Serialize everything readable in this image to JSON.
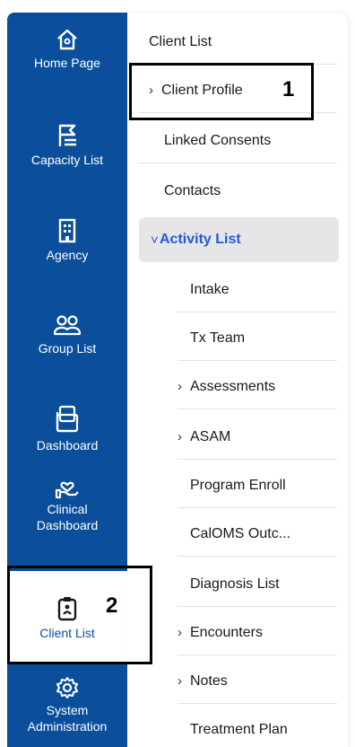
{
  "rail": {
    "items": [
      {
        "label": "Home Page",
        "icon": "home-icon"
      },
      {
        "label": "Capacity List",
        "icon": "flag-list-icon"
      },
      {
        "label": "Agency",
        "icon": "building-icon"
      },
      {
        "label": "Group List",
        "icon": "group-icon"
      },
      {
        "label": "Dashboard",
        "icon": "dashboard-icon"
      },
      {
        "label": "Clinical Dashboard",
        "label_line1": "Clinical",
        "label_line2": "Dashboard",
        "icon": "hand-heart-icon"
      },
      {
        "label": "Client List",
        "icon": "clipboard-user-icon"
      },
      {
        "label": "System Administration",
        "label_line1": "System",
        "label_line2": "Administration",
        "icon": "gear-icon"
      }
    ]
  },
  "menu": {
    "client_list": "Client List",
    "client_profile": "Client Profile",
    "linked_consents": "Linked Consents",
    "contacts": "Contacts",
    "activity_list": "Activity List",
    "intake": "Intake",
    "tx_team": "Tx Team",
    "assessments": "Assessments",
    "asam": "ASAM",
    "program_enroll": "Program Enroll",
    "caloms": "CalOMS Outc...",
    "diagnosis_list": "Diagnosis List",
    "encounters": "Encounters",
    "notes": "Notes",
    "treatment_plan": "Treatment Plan"
  },
  "callouts": {
    "one": "1",
    "two": "2"
  },
  "colors": {
    "rail_bg": "#0b4f9c",
    "active_text": "#1e5ed6",
    "open_bg": "#e6e6e8"
  }
}
